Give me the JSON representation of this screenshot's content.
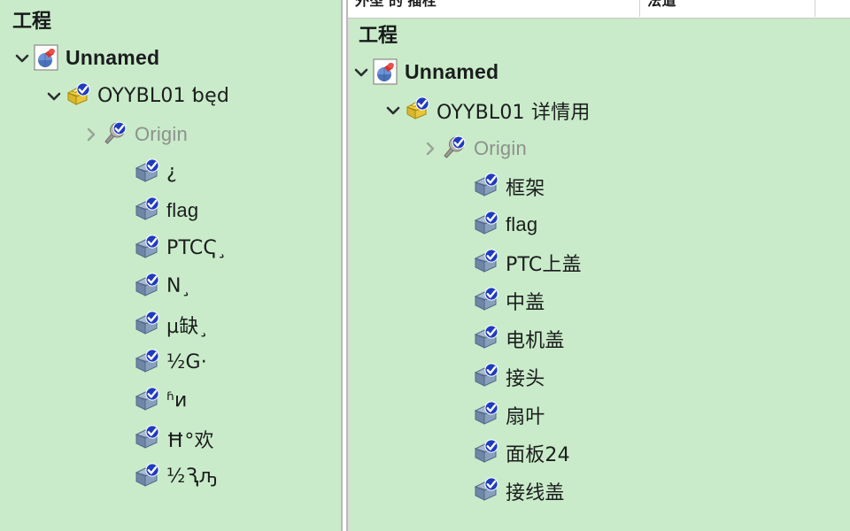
{
  "meta": {
    "background_color": "#c9ebc9",
    "divider_color": "#b9b9b9",
    "text_color": "#1b1d1e",
    "dim_text_color": "#8d918d",
    "check_badge_color": "#1f3bbf",
    "assembly_icon_color": "#e8c72a",
    "part_icon_color": "#7e95b5"
  },
  "toolbar": {
    "cells": [
      {
        "name": "cell-properties",
        "clipped_text": "外型 的 插栓"
      },
      {
        "name": "cell-option",
        "clipped_text": "法道"
      },
      {
        "name": "cell-end",
        "clipped_text": ""
      }
    ]
  },
  "left_panel": {
    "title": "工程",
    "nodes": [
      {
        "level": 0,
        "twisty": "expanded",
        "icon": "document-icon",
        "label": "Unnamed",
        "style": "bold"
      },
      {
        "level": 1,
        "twisty": "expanded",
        "icon": "assembly-icon",
        "label": "OYYBL01 ƅęd",
        "style": "garbled"
      },
      {
        "level": 2,
        "twisty": "collapsed",
        "icon": "origin-icon",
        "label": "Origin",
        "style": "dim"
      },
      {
        "level": 3,
        "twisty": "none",
        "icon": "part-icon",
        "label": "¿",
        "style": "garbled"
      },
      {
        "level": 3,
        "twisty": "none",
        "icon": "part-icon",
        "label": "flag",
        "style": "normal"
      },
      {
        "level": 3,
        "twisty": "none",
        "icon": "part-icon",
        "label": "PTCҀ¸",
        "style": "garbled"
      },
      {
        "level": 3,
        "twisty": "none",
        "icon": "part-icon",
        "label": "Ν¸",
        "style": "garbled"
      },
      {
        "level": 3,
        "twisty": "none",
        "icon": "part-icon",
        "label": "µ缺¸",
        "style": "garbled"
      },
      {
        "level": 3,
        "twisty": "none",
        "icon": "part-icon",
        "label": "½G·",
        "style": "garbled"
      },
      {
        "level": 3,
        "twisty": "none",
        "icon": "part-icon",
        "label": "ʱͷ",
        "style": "garbled"
      },
      {
        "level": 3,
        "twisty": "none",
        "icon": "part-icon",
        "label": "Ħ°欢",
        "style": "garbled"
      },
      {
        "level": 3,
        "twisty": "none",
        "icon": "part-icon",
        "label": "½Ԇԡ",
        "style": "garbled"
      }
    ]
  },
  "right_panel": {
    "title": "工程",
    "nodes": [
      {
        "level": 0,
        "twisty": "expanded",
        "icon": "document-icon",
        "label": "Unnamed",
        "style": "bold"
      },
      {
        "level": 1,
        "twisty": "expanded",
        "icon": "assembly-icon",
        "label": "OYYBL01 详情用",
        "style": "cjk"
      },
      {
        "level": 2,
        "twisty": "collapsed",
        "icon": "origin-icon",
        "label": "Origin",
        "style": "dim"
      },
      {
        "level": 3,
        "twisty": "none",
        "icon": "part-icon",
        "label": "框架",
        "style": "cjk"
      },
      {
        "level": 3,
        "twisty": "none",
        "icon": "part-icon",
        "label": "flag",
        "style": "normal"
      },
      {
        "level": 3,
        "twisty": "none",
        "icon": "part-icon",
        "label": "PTC上盖",
        "style": "cjk"
      },
      {
        "level": 3,
        "twisty": "none",
        "icon": "part-icon",
        "label": "中盖",
        "style": "cjk"
      },
      {
        "level": 3,
        "twisty": "none",
        "icon": "part-icon",
        "label": "电机盖",
        "style": "cjk"
      },
      {
        "level": 3,
        "twisty": "none",
        "icon": "part-icon",
        "label": "接头",
        "style": "cjk"
      },
      {
        "level": 3,
        "twisty": "none",
        "icon": "part-icon",
        "label": "扇叶",
        "style": "cjk"
      },
      {
        "level": 3,
        "twisty": "none",
        "icon": "part-icon",
        "label": "面板24",
        "style": "cjk"
      },
      {
        "level": 3,
        "twisty": "none",
        "icon": "part-icon",
        "label": "接线盖",
        "style": "cjk"
      }
    ]
  }
}
